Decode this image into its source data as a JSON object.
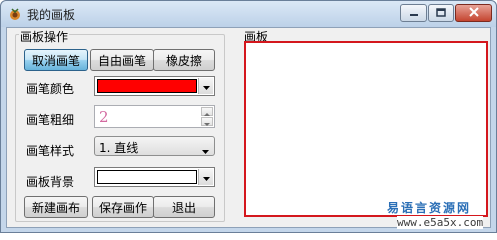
{
  "window": {
    "title": "我的画板",
    "minimize_glyph": "▁",
    "maximize_glyph": "▢",
    "close_glyph": "✕"
  },
  "ops_group": {
    "label": "画板操作",
    "buttons": {
      "cancel": "取消画笔",
      "free": "自由画笔",
      "eraser": "橡皮擦",
      "new": "新建画布",
      "save": "保存画作",
      "exit": "退出"
    },
    "pen_color": {
      "label": "画笔颜色",
      "value_color": "#ff0000"
    },
    "pen_width": {
      "label": "画笔粗细",
      "value": "2"
    },
    "pen_style": {
      "label": "画笔样式",
      "value": "1. 直线"
    },
    "background": {
      "label": "画板背景",
      "value_color": "#ffffff"
    }
  },
  "canvas_group": {
    "label": "画板",
    "border_color": "#d4171d"
  },
  "watermark": {
    "cn": "易语言资源网",
    "url": "www.e5a5x.com"
  }
}
